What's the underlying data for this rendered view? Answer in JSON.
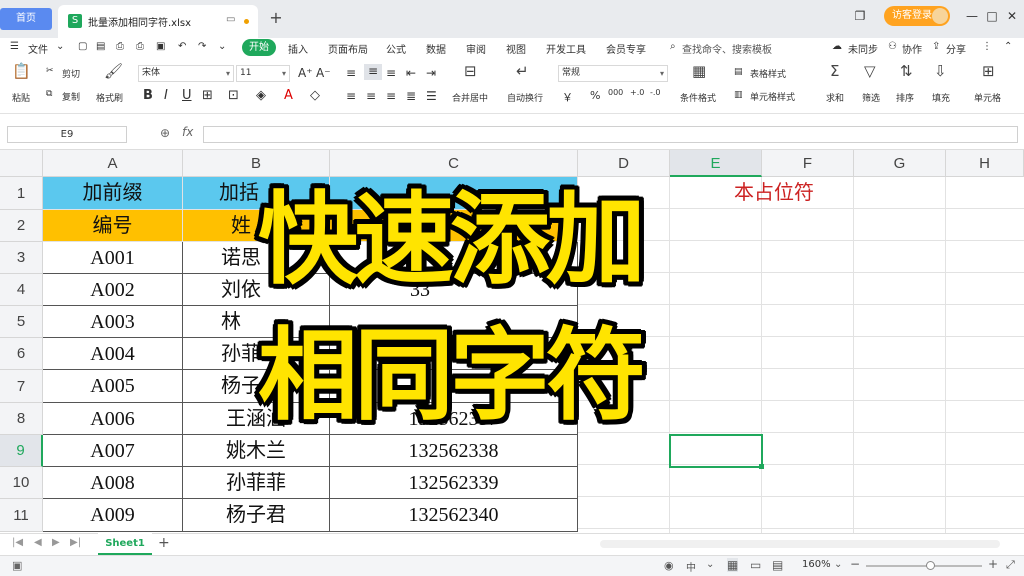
{
  "titlebar": {
    "home_tab": "首页",
    "file_tab": "批量添加相同字符.xlsx",
    "file_logo": "S",
    "login": "访客登录",
    "new_tab": "+",
    "min": "—",
    "max": "□",
    "close": "✕",
    "layout": "❐",
    "restore": "⧉"
  },
  "menubar": {
    "file_menu": "文件",
    "items": [
      "开始",
      "插入",
      "页面布局",
      "公式",
      "数据",
      "审阅",
      "视图",
      "开发工具",
      "会员专享"
    ],
    "search": "查找命令、搜索模板",
    "sync": "未同步",
    "collab": "协作",
    "share": "分享"
  },
  "ribbon": {
    "paste": "粘贴",
    "cut": "剪切",
    "copy": "复制",
    "format_painter": "格式刷",
    "font": "宋体",
    "font_size": "11",
    "merge": "合并居中",
    "wrap": "自动换行",
    "number_format": "常规",
    "cond_format": "条件格式",
    "table_style": "表格样式",
    "cell_style": "单元格样式",
    "sum": "求和",
    "filter": "筛选",
    "sort": "排序",
    "fill": "填充",
    "cell": "单元格",
    "bold": "B",
    "italic": "I",
    "underline": "U",
    "percent": "%",
    "currency": "￥"
  },
  "formula": {
    "name_box": "E9",
    "fx": "fx",
    "value": ""
  },
  "grid": {
    "columns": [
      "A",
      "B",
      "C",
      "D",
      "E",
      "F",
      "G",
      "H"
    ],
    "rows": [
      "1",
      "2",
      "3",
      "4",
      "5",
      "6",
      "7",
      "8",
      "9",
      "10",
      "11"
    ],
    "row1": [
      "加前缀",
      "加括"
    ],
    "row1_f": "本占位符",
    "row2": [
      "编号",
      "姓"
    ],
    "data": [
      [
        "A001",
        "诺思",
        ""
      ],
      [
        "A002",
        "刘依",
        "33"
      ],
      [
        "A003",
        "林",
        ""
      ],
      [
        "A004",
        "孙菲",
        ""
      ],
      [
        "A005",
        "杨子",
        "6"
      ],
      [
        "A006",
        "王涵涵",
        "132562337"
      ],
      [
        "A007",
        "姚木兰",
        "132562338"
      ],
      [
        "A008",
        "孙菲菲",
        "132562339"
      ],
      [
        "A009",
        "杨子君",
        "132562340"
      ]
    ]
  },
  "overlay": {
    "line1": "快速添加",
    "line2": "相同字符"
  },
  "sheets": {
    "tab": "Sheet1",
    "add": "+"
  },
  "status": {
    "zoom": "160%",
    "input_mode": "中"
  },
  "colors": {
    "row1_bg": "#5bc8ee",
    "row2_bg": "#ffc000",
    "accent": "#1fa85c",
    "overlay": "#ffe400",
    "red_text": "#cc2222"
  }
}
